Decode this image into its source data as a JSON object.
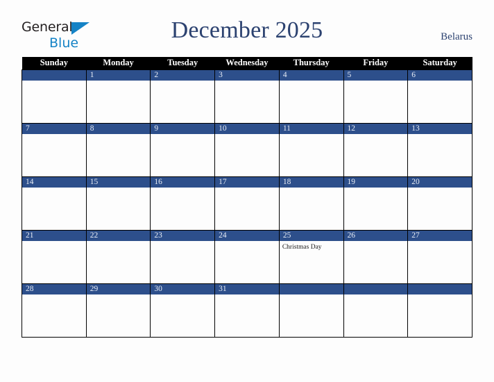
{
  "brand": {
    "name_part1": "General",
    "name_part2": "Blue",
    "triangle_icon": "blue-triangle-icon",
    "accent_color": "#1583c6"
  },
  "header": {
    "title": "December 2025",
    "region": "Belarus",
    "title_color": "#2c4270"
  },
  "calendar": {
    "month": "December",
    "year": "2025",
    "weekday_headers": [
      "Sunday",
      "Monday",
      "Tuesday",
      "Wednesday",
      "Thursday",
      "Friday",
      "Saturday"
    ],
    "header_bg": "#000000",
    "header_text_color": "#ffffff",
    "daybar_bg": "#2d4f8b",
    "daybar_text_color": "#e7ecf5",
    "grid_border_color": "#000000",
    "cell_bg": "#fdfdfd",
    "weeks": [
      [
        {
          "date": "",
          "event": "",
          "blank": true
        },
        {
          "date": "1",
          "event": ""
        },
        {
          "date": "2",
          "event": ""
        },
        {
          "date": "3",
          "event": ""
        },
        {
          "date": "4",
          "event": ""
        },
        {
          "date": "5",
          "event": ""
        },
        {
          "date": "6",
          "event": ""
        }
      ],
      [
        {
          "date": "7",
          "event": ""
        },
        {
          "date": "8",
          "event": ""
        },
        {
          "date": "9",
          "event": ""
        },
        {
          "date": "10",
          "event": ""
        },
        {
          "date": "11",
          "event": ""
        },
        {
          "date": "12",
          "event": ""
        },
        {
          "date": "13",
          "event": ""
        }
      ],
      [
        {
          "date": "14",
          "event": ""
        },
        {
          "date": "15",
          "event": ""
        },
        {
          "date": "16",
          "event": ""
        },
        {
          "date": "17",
          "event": ""
        },
        {
          "date": "18",
          "event": ""
        },
        {
          "date": "19",
          "event": ""
        },
        {
          "date": "20",
          "event": ""
        }
      ],
      [
        {
          "date": "21",
          "event": ""
        },
        {
          "date": "22",
          "event": ""
        },
        {
          "date": "23",
          "event": ""
        },
        {
          "date": "24",
          "event": ""
        },
        {
          "date": "25",
          "event": "Christmas Day"
        },
        {
          "date": "26",
          "event": ""
        },
        {
          "date": "27",
          "event": ""
        }
      ],
      [
        {
          "date": "28",
          "event": ""
        },
        {
          "date": "29",
          "event": ""
        },
        {
          "date": "30",
          "event": ""
        },
        {
          "date": "31",
          "event": ""
        },
        {
          "date": "",
          "event": "",
          "blank": true
        },
        {
          "date": "",
          "event": "",
          "blank": true
        },
        {
          "date": "",
          "event": "",
          "blank": true
        }
      ]
    ]
  }
}
